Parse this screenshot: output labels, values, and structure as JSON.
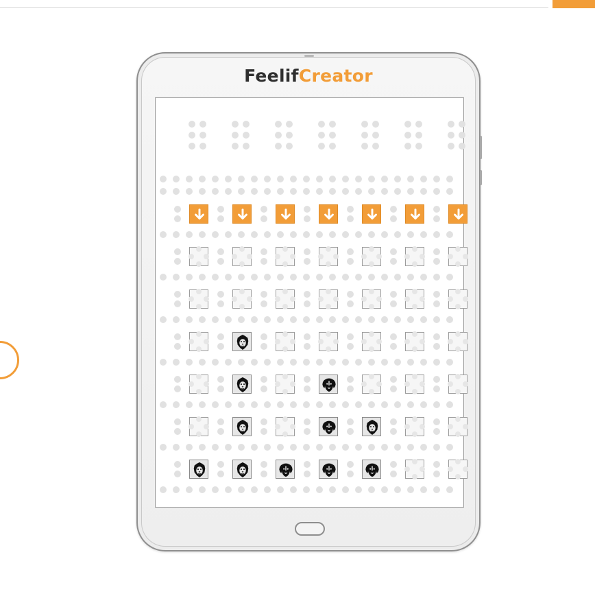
{
  "app": {
    "brand_primary": "Feelif",
    "brand_secondary": "Creator"
  },
  "colors": {
    "accent": "#f29d38",
    "dot": "#e1e1e1",
    "cell_border": "#9c9c9c",
    "piece": "#111111"
  },
  "board": {
    "columns": 7,
    "rows": 6,
    "drop_icon": "arrow-down-icon",
    "pieces": [
      [
        null,
        null,
        null,
        null,
        null,
        null,
        null
      ],
      [
        null,
        null,
        null,
        null,
        null,
        null,
        null
      ],
      [
        null,
        "lion",
        null,
        null,
        null,
        null,
        null
      ],
      [
        null,
        "lion",
        null,
        "dog",
        null,
        null,
        null
      ],
      [
        null,
        "lion",
        null,
        "dog",
        "lion",
        null,
        null
      ],
      [
        "lion",
        "lion",
        "dog",
        "dog",
        "dog",
        null,
        null
      ]
    ],
    "piece_icons": {
      "lion": "lion-head-icon",
      "dog": "dog-head-icon"
    }
  }
}
